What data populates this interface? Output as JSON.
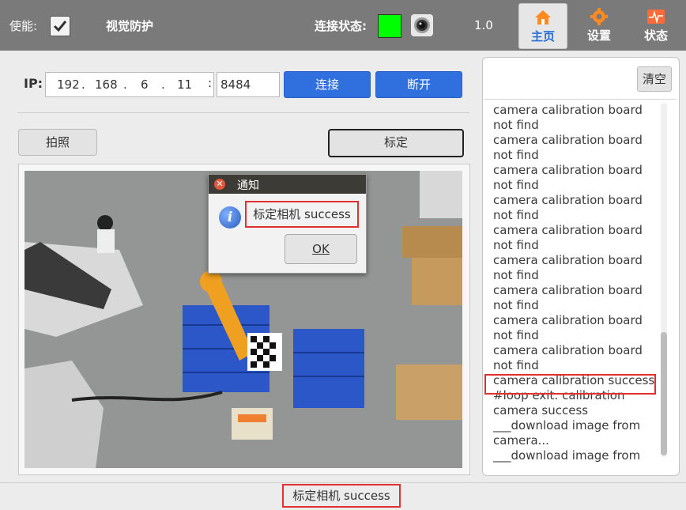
{
  "topbar": {
    "enable_label": "使能:",
    "vision_label": "视觉防护",
    "connection_label": "连接状态:",
    "connection_color": "#00ff00",
    "version": "1.0",
    "nav": [
      {
        "label": "主页",
        "icon": "home-icon",
        "active": true
      },
      {
        "label": "设置",
        "icon": "gear-icon",
        "active": false
      },
      {
        "label": "状态",
        "icon": "status-icon",
        "active": false
      }
    ]
  },
  "connection": {
    "ip_label": "IP:",
    "ip_parts": [
      "192",
      "168",
      "6",
      "11"
    ],
    "port": "8484",
    "connect_label": "连接",
    "disconnect_label": "断开"
  },
  "actions": {
    "photo_label": "拍照",
    "calibrate_label": "标定"
  },
  "log": {
    "clear_label": "清空",
    "lines": [
      "camera  calibration board",
      "not find",
      "camera  calibration board",
      "not find",
      "camera  calibration board",
      "not find",
      "camera  calibration board",
      "not find",
      "camera  calibration board",
      "not find",
      "camera  calibration board",
      "not find",
      "camera  calibration board",
      "not find",
      "camera  calibration board",
      "not find",
      "camera  calibration board",
      "not find",
      "camera  calibration success",
      "#loop exit: calibration",
      "camera success",
      "___download image from",
      "camera...",
      "___download image from"
    ]
  },
  "dialog": {
    "title": "通知",
    "message": "标定相机  success",
    "ok_label": "OK"
  },
  "status": {
    "text": "标定相机  success"
  },
  "colors": {
    "accent": "#2f6fde",
    "highlight": "#e03030"
  }
}
